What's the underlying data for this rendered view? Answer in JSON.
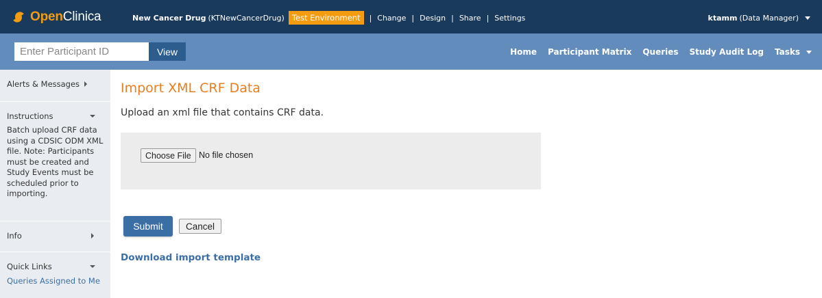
{
  "header": {
    "logo_open": "Open",
    "logo_clinica": "Clinica",
    "study_name": "New Cancer Drug",
    "study_id": "(KTNewCancerDrug)",
    "environment_badge": "Test Environment",
    "links": [
      "Change",
      "Design",
      "Share",
      "Settings"
    ],
    "separator": "|",
    "user_name": "ktamm",
    "user_role": "(Data Manager)"
  },
  "navbar": {
    "participant_placeholder": "Enter Participant ID",
    "view_label": "View",
    "links": [
      "Home",
      "Participant Matrix",
      "Queries",
      "Study Audit Log",
      "Tasks"
    ]
  },
  "sidebar": {
    "alerts": "Alerts & Messages",
    "instructions_title": "Instructions",
    "instructions_text": "Batch upload CRF data using a CDSIC ODM XML file. Note: Participants must be created and Study Events must be scheduled prior to importing.",
    "info": "Info",
    "quick_links_title": "Quick Links",
    "quick_link_1": "Queries Assigned to Me"
  },
  "main": {
    "title": "Import XML CRF Data",
    "intro": "Upload an xml file that contains CRF data.",
    "choose_file": "Choose File",
    "no_file": "No file chosen",
    "submit": "Submit",
    "cancel": "Cancel",
    "download_template": "Download import template"
  },
  "colors": {
    "topbar": "#1a3a5c",
    "navbar": "#618cbb",
    "accent_orange": "#f39c12",
    "title_orange": "#e67e22",
    "link_blue": "#3a6ea5"
  }
}
